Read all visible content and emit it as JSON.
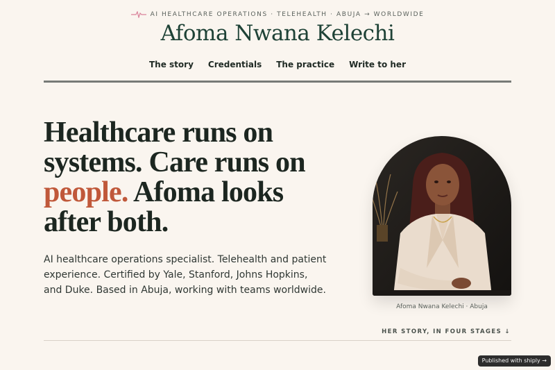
{
  "header": {
    "eyebrow": "AI HEALTHCARE OPERATIONS · TELEHEALTH · ABUJA → WORLDWIDE",
    "site_title": "Afoma Nwana Kelechi"
  },
  "nav": {
    "items": [
      {
        "label": "The story"
      },
      {
        "label": "Credentials"
      },
      {
        "label": "The practice"
      },
      {
        "label": "Write to her"
      }
    ]
  },
  "hero": {
    "headline_part1": "Healthcare runs on systems. Care runs on ",
    "headline_accent": "people.",
    "headline_part2": " Afoma looks after both.",
    "intro": "AI healthcare operations specialist. Telehealth and patient experience. Certified by Yale, Stanford, Johns Hopkins, and Duke. Based in Abuja, working with teams worldwide.",
    "portrait_caption": "Afoma Nwana Kelechi · Abuja",
    "story_link": "HER STORY, IN FOUR STAGES ↓"
  },
  "badge": {
    "label": "Published with shiply →"
  },
  "colors": {
    "background": "#faf5ef",
    "title": "#1e4236",
    "accent": "#c0583a",
    "pulse": "#d9829a"
  },
  "icons": {
    "eyebrow_icon": "heartbeat-pulse-icon"
  }
}
